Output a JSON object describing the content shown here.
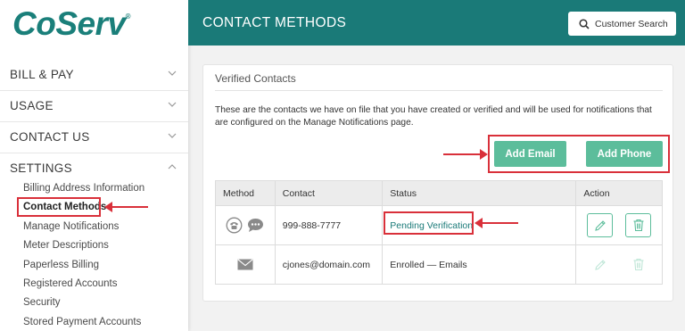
{
  "brand": {
    "logo_text": "CoServ",
    "logo_mark": "®",
    "accent": "#1a7a78",
    "button_green": "#5cbd9b",
    "highlight_red": "#d9303a"
  },
  "header": {
    "title": "CONTACT METHODS",
    "search_label": "Customer Search",
    "search_icon": "search-icon"
  },
  "sidebar": {
    "sections": [
      {
        "label": "BILL & PAY",
        "expanded": false
      },
      {
        "label": "USAGE",
        "expanded": false
      },
      {
        "label": "CONTACT US",
        "expanded": false
      },
      {
        "label": "SETTINGS",
        "expanded": true
      }
    ],
    "settings_items": [
      {
        "label": "Billing Address Information",
        "active": false
      },
      {
        "label": "Contact Methods",
        "active": true
      },
      {
        "label": "Manage Notifications",
        "active": false
      },
      {
        "label": "Meter Descriptions",
        "active": false
      },
      {
        "label": "Paperless Billing",
        "active": false
      },
      {
        "label": "Registered Accounts",
        "active": false
      },
      {
        "label": "Security",
        "active": false
      },
      {
        "label": "Stored Payment Accounts",
        "active": false
      }
    ]
  },
  "card": {
    "title": "Verified Contacts",
    "description": "These are the contacts we have on file that you have created or verified and will be used for notifications that are configured on the Manage Notifications page.",
    "add_email_label": "Add Email",
    "add_phone_label": "Add Phone"
  },
  "table": {
    "headers": [
      "Method",
      "Contact",
      "Status",
      "Action"
    ],
    "rows": [
      {
        "method_icons": [
          "phone-icon",
          "chat-icon"
        ],
        "contact": "999-888-7777",
        "status": "Pending Verification",
        "actions_enabled": true
      },
      {
        "method_icons": [
          "email-icon"
        ],
        "contact": "cjones@domain.com",
        "status": "Enrolled — Emails",
        "actions_enabled": false
      }
    ]
  }
}
